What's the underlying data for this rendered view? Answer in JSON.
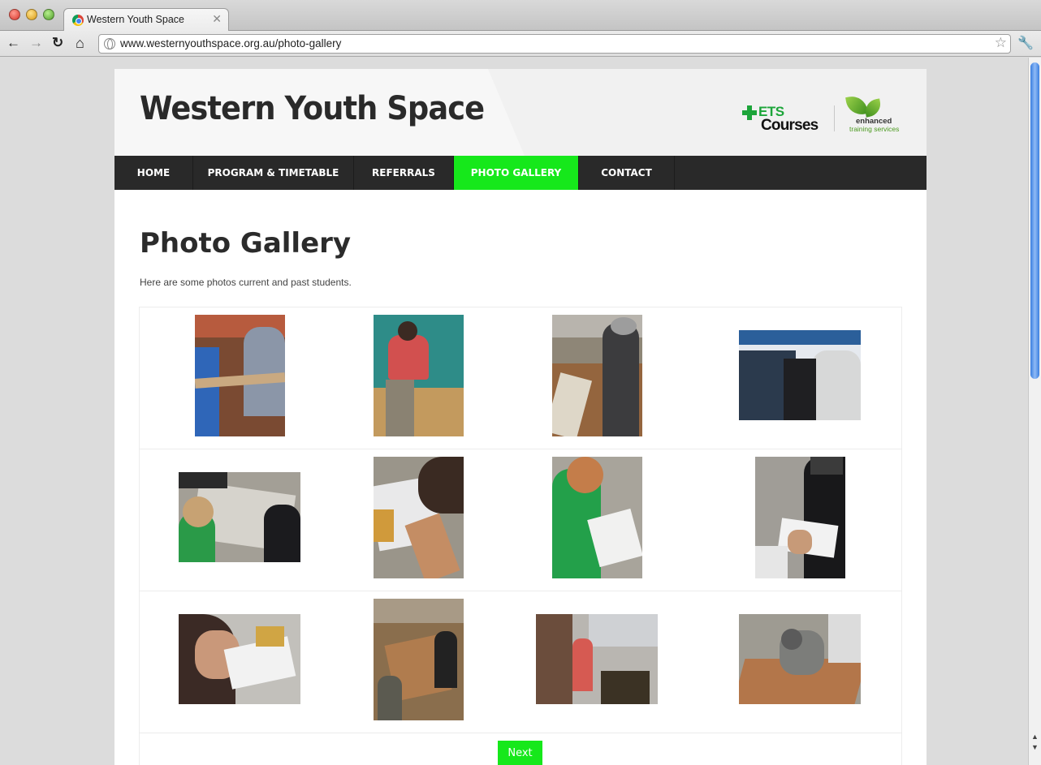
{
  "browser": {
    "tab_title": "Western Youth Space",
    "tab_close": "✕",
    "url": "www.westernyouthspace.org.au/photo-gallery",
    "icons": [
      "back-icon",
      "forward-icon",
      "reload-icon",
      "home-icon",
      "globe-icon",
      "star-icon",
      "wrench-icon"
    ]
  },
  "header": {
    "site_title": "Western Youth Space",
    "logo_ets": "ETS",
    "logo_courses": "Courses",
    "logo_enhanced": "enhanced",
    "logo_training": "training services"
  },
  "nav": {
    "items": [
      {
        "label": "HOME",
        "active": false
      },
      {
        "label": "PROGRAM & TIMETABLE",
        "active": false
      },
      {
        "label": "REFERRALS",
        "active": false
      },
      {
        "label": "PHOTO GALLERY",
        "active": true
      },
      {
        "label": "CONTACT",
        "active": false
      }
    ]
  },
  "content": {
    "title": "Photo Gallery",
    "intro": "Here are some photos current and past students."
  },
  "gallery": {
    "rows": [
      [
        "portrait",
        "portrait",
        "portrait",
        "landscape"
      ],
      [
        "landscape",
        "portrait",
        "portrait",
        "portrait"
      ],
      [
        "landscape",
        "portrait",
        "landscape",
        "landscape"
      ]
    ],
    "next_label": "Next"
  },
  "colors": {
    "accent_green": "#16e81b",
    "nav_bg": "#292929",
    "title_text": "#2a2a2a"
  }
}
